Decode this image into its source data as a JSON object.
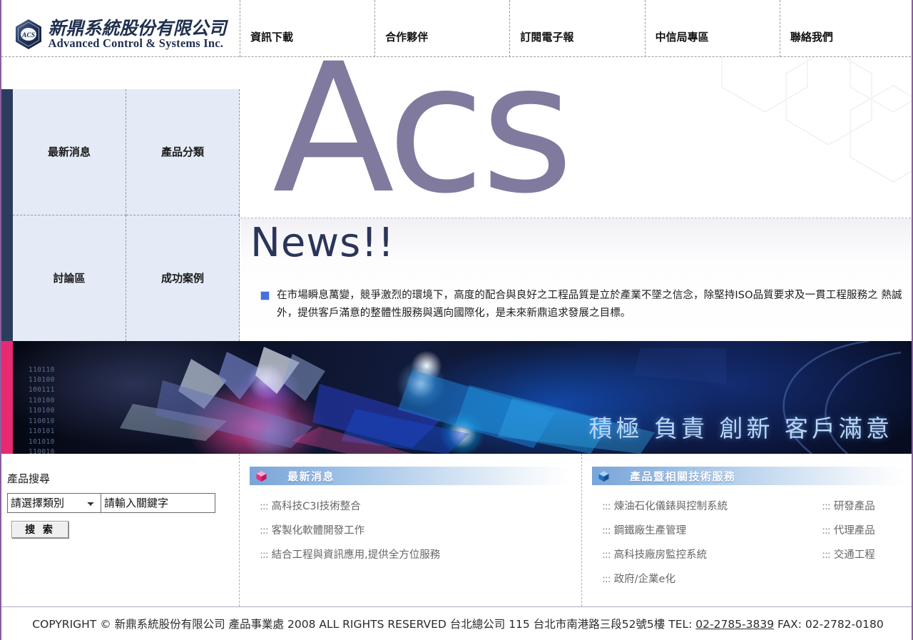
{
  "brand": {
    "logo_cn": "新鼎系統股份有限公司",
    "logo_en": "Advanced Control & Systems Inc.",
    "logo_mark": "ACS"
  },
  "nav": {
    "items": [
      {
        "label": "資訊下載"
      },
      {
        "label": "合作夥伴"
      },
      {
        "label": "訂閱電子報"
      },
      {
        "label": "中信局專區"
      },
      {
        "label": "聯絡我們"
      }
    ]
  },
  "sidebar": {
    "items": [
      {
        "label": "最新消息"
      },
      {
        "label": "產品分類"
      },
      {
        "label": "討論區"
      },
      {
        "label": "成功案例"
      }
    ]
  },
  "hero": {
    "wordmark": "Acs",
    "news_heading": "News!!",
    "news_paragraph": "在市場瞬息萬變，競爭激烈的環境下，高度的配合與良好之工程品質是立於產業不墜之信念，除堅持ISO品質要求及一貫工程服務之 熱誠外，提供客戶滿意的整體性服務與邁向國際化，是未來新鼎追求發展之目標。"
  },
  "banner": {
    "slogan": "積極  負責  創新  客戶滿意",
    "binary": "110110\n110100\n100111\n110100\n110100\n110010\n110101\n101010\n110010"
  },
  "search": {
    "title": "產品搜尋",
    "category_selected": "請選擇類別",
    "category_options": [
      "請選擇類別"
    ],
    "keyword_placeholder": "請輸入關鍵字",
    "submit_label": "搜 索"
  },
  "panels": {
    "news": {
      "title": "最新消息",
      "icon": "pink-cube-icon",
      "items": [
        "高科技C3I技術整合",
        "客製化軟體開發工作",
        "結合工程與資訊應用,提供全方位服務"
      ]
    },
    "products": {
      "title": "產品暨相關技術服務",
      "icon": "blue-cube-icon",
      "items_left": [
        "煉油石化儀錶與控制系統",
        "鋼鐵廠生產管理",
        "高科技廠房監控系統",
        "政府/企業e化"
      ],
      "items_right": [
        "研發產品",
        "代理產品",
        "交通工程"
      ]
    }
  },
  "footer": {
    "text_before": "COPYRIGHT © 新鼎系統股份有限公司 產品事業處 2008 ALL RIGHTS RESERVED 台北總公司 115 台北市南港路三段52號5樓 TEL: ",
    "tel": "02-2785-3839",
    "text_after": " FAX: 02-2782-0180"
  },
  "colors": {
    "accent_purple": "#807a9e",
    "navy": "#2d3c5e",
    "pink": "#e72a72",
    "sidebar_bg": "#e4ebf7",
    "border_purple": "#8a5f9e"
  },
  "bullets": {
    "dots": ":::"
  }
}
